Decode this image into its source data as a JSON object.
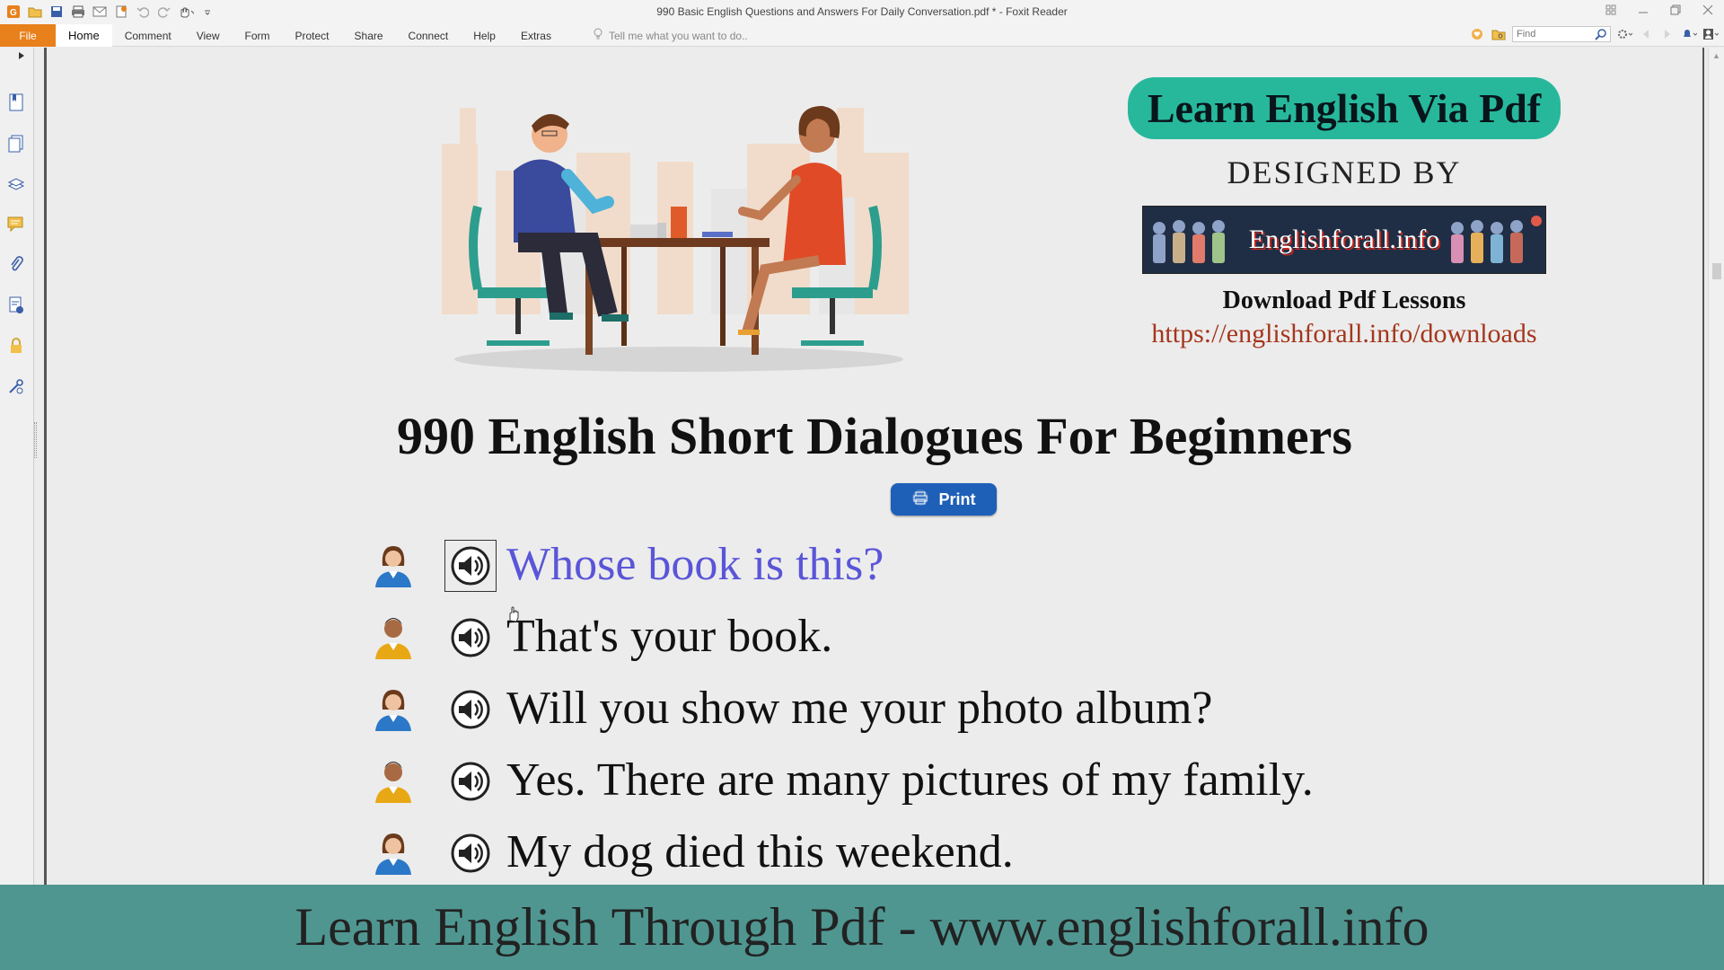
{
  "window": {
    "title": "990 Basic English Questions and Answers For Daily Conversation.pdf * - Foxit Reader"
  },
  "menu": {
    "file_label": "File",
    "tabs": [
      "Home",
      "Comment",
      "View",
      "Form",
      "Protect",
      "Share",
      "Connect",
      "Help",
      "Extras"
    ],
    "active_tab": "Home",
    "tell_me_placeholder": "Tell me what you want to do..",
    "find_placeholder": "Find"
  },
  "left_panel": {
    "icons": [
      "bookmark-icon",
      "pages-icon",
      "layers-icon",
      "comments-icon",
      "attachments-icon",
      "signature-icon",
      "security-icon",
      "tools-icon"
    ]
  },
  "document": {
    "brand_title": "Learn English Via Pdf",
    "designed_by": "DESIGNED BY",
    "banner_text": "Englishforall.info",
    "download_title": "Download Pdf Lessons",
    "download_url": "https://englishforall.info/downloads",
    "main_title": "990 English Short Dialogues For Beginners",
    "print_label": "Print",
    "dialogue": [
      {
        "speaker": "female",
        "text": "Whose book is this?",
        "highlighted": true
      },
      {
        "speaker": "male",
        "text": "That's your book.",
        "highlighted": false
      },
      {
        "speaker": "female",
        "text": "Will you show me your photo album?",
        "highlighted": false
      },
      {
        "speaker": "male",
        "text": "Yes. There are many pictures of my family.",
        "highlighted": false
      },
      {
        "speaker": "female",
        "text": "My dog died this weekend.",
        "highlighted": false
      }
    ]
  },
  "footer": {
    "text": "Learn English Through Pdf - www.englishforall.info"
  },
  "colors": {
    "file_tab": "#e8801b",
    "brand_pill": "#27b89c",
    "print_button": "#1e5fb8",
    "highlight_text": "#5a55d8",
    "footer_bg": "#4f9691",
    "url_text": "#a4361c"
  }
}
